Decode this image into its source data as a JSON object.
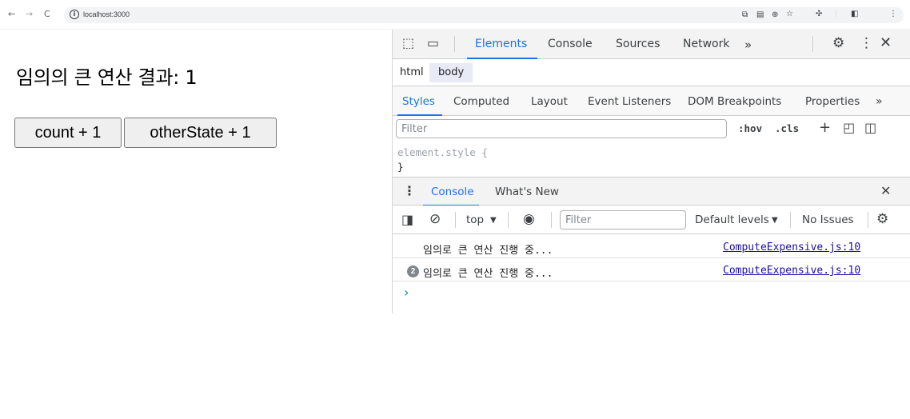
{
  "browser": {
    "back": "←",
    "forward": "→",
    "reload": "C",
    "url": "localhost:3000"
  },
  "page": {
    "title": "임의의 큰 연산 결과: 1",
    "buttons": [
      "count + 1",
      "otherState + 1"
    ]
  },
  "devtools": {
    "tabs": [
      "Elements",
      "Console",
      "Sources",
      "Network"
    ],
    "more": "»",
    "breadcrumbs": [
      "html",
      "body"
    ],
    "subtabs": [
      "Styles",
      "Computed",
      "Layout",
      "Event Listeners",
      "DOM Breakpoints",
      "Properties"
    ],
    "filter_placeholder": "Filter",
    "hov": ":hov",
    "cls": ".cls",
    "style_rule_open": "element.style {",
    "style_rule_close": "}",
    "drawer_tabs": [
      "Console",
      "What's New"
    ],
    "console": {
      "context": "top",
      "filter_placeholder": "Filter",
      "levels": "Default levels",
      "issues": "No Issues",
      "logs": [
        {
          "count": "",
          "message": "임의로 큰 연산 진행 중...",
          "source": "ComputeExpensive.js:10"
        },
        {
          "count": "2",
          "message": "임의로 큰 연산 진행 중...",
          "source": "ComputeExpensive.js:10"
        }
      ],
      "prompt": "›"
    }
  },
  "colors": {
    "accent": "#1a73e8",
    "link": "#1a0dab"
  }
}
